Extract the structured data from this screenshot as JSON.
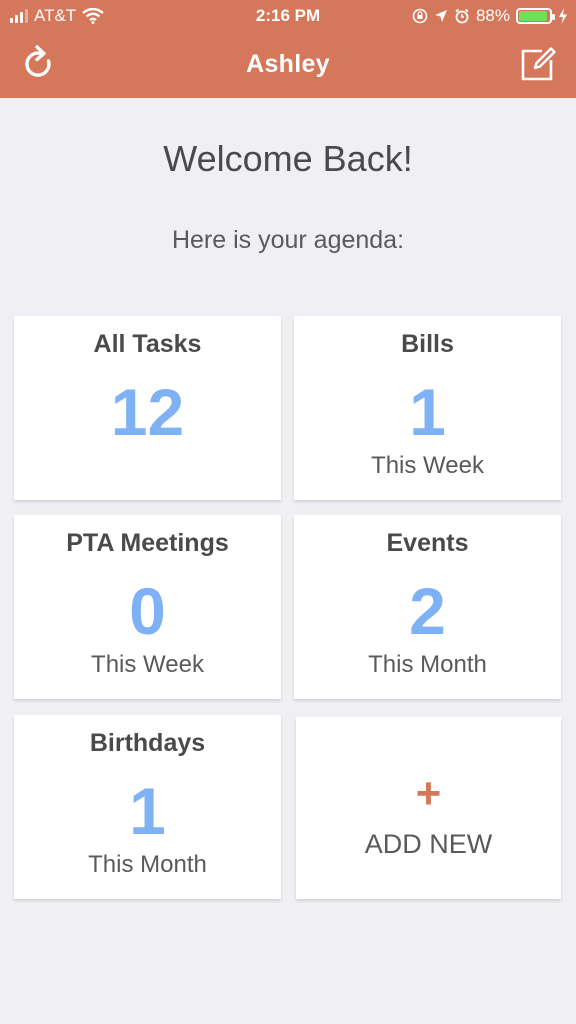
{
  "status_bar": {
    "carrier": "AT&T",
    "time": "2:16 PM",
    "battery_percent": "88%",
    "battery_level": 0.88
  },
  "nav": {
    "title": "Ashley",
    "left_icon": "refresh-icon",
    "right_icon": "compose-icon"
  },
  "main": {
    "welcome": "Welcome Back!",
    "agenda": "Here is your agenda:"
  },
  "cards": [
    {
      "title": "All Tasks",
      "count": "12",
      "period": ""
    },
    {
      "title": "Bills",
      "count": "1",
      "period": "This Week"
    },
    {
      "title": "PTA Meetings",
      "count": "0",
      "period": "This Week"
    },
    {
      "title": "Events",
      "count": "2",
      "period": "This Month"
    },
    {
      "title": "Birthdays",
      "count": "1",
      "period": "This Month"
    }
  ],
  "add_new": {
    "plus": "+",
    "label": "ADD NEW"
  },
  "colors": {
    "accent": "#d5775b",
    "count_blue": "#7fb2f5",
    "background": "#efeff4"
  }
}
